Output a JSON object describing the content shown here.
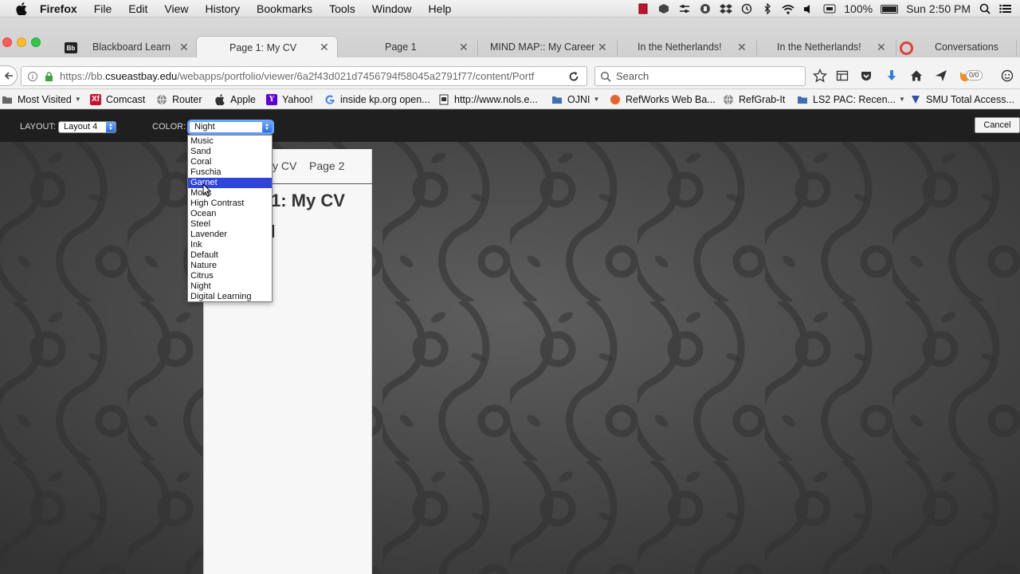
{
  "menubar": {
    "app_name": "Firefox",
    "items": [
      "File",
      "Edit",
      "View",
      "History",
      "Bookmarks",
      "Tools",
      "Window",
      "Help"
    ],
    "battery": "100%",
    "clock": "Sun 2:50 PM"
  },
  "tabs": [
    {
      "label": "Blackboard Learn",
      "active": false
    },
    {
      "label": "Page 1: My CV",
      "active": true
    },
    {
      "label": "Page 1",
      "active": false
    },
    {
      "label": "MIND MAP:: My Career",
      "active": false
    },
    {
      "label": "In the Netherlands!",
      "active": false
    },
    {
      "label": "In the Netherlands!",
      "active": false
    },
    {
      "label": "Conversations",
      "active": false
    }
  ],
  "nav": {
    "url_prefix": "https://bb.",
    "url_domain": "csueastbay.edu",
    "url_path": "/webapps/portfolio/viewer/6a2f43d021d7456794f58045a2791f77/content/Portf",
    "search_placeholder": "Search",
    "badge": "0/0"
  },
  "bookmarks": [
    {
      "label": "Most Visited",
      "caret": true
    },
    {
      "label": "Comcast",
      "caret": false
    },
    {
      "label": "Router",
      "caret": false
    },
    {
      "label": "Apple",
      "caret": false
    },
    {
      "label": "Yahoo!",
      "caret": false
    },
    {
      "label": "inside kp.org open...",
      "caret": false
    },
    {
      "label": "http://www.nols.e...",
      "caret": false
    },
    {
      "label": "OJNI",
      "caret": true
    },
    {
      "label": "RefWorks Web Ba...",
      "caret": false
    },
    {
      "label": "RefGrab-It",
      "caret": false
    },
    {
      "label": "LS2 PAC: Recen...",
      "caret": true
    },
    {
      "label": "SMU Total Access...",
      "caret": false
    }
  ],
  "editor": {
    "layout_label": "LAYOUT:",
    "layout_value": "Layout 4",
    "color_label": "COLOR:",
    "color_value": "Night",
    "cancel_label": "Cancel"
  },
  "page": {
    "nav_link_1": "y CV",
    "nav_link_2": "Page 2",
    "heading": "1: My CV"
  },
  "color_options": [
    "Music",
    "Sand",
    "Coral",
    "Fuschia",
    "Garnet",
    "Moss",
    "High Contrast",
    "Ocean",
    "Steel",
    "Lavender",
    "Ink",
    "Default",
    "Nature",
    "Citrus",
    "Night",
    "Digital Learning"
  ],
  "highlighted_option": "Garnet",
  "colors": {
    "highlight": "#2f44d9",
    "editor_bar": "#1f1f1f",
    "background": "#424242"
  }
}
